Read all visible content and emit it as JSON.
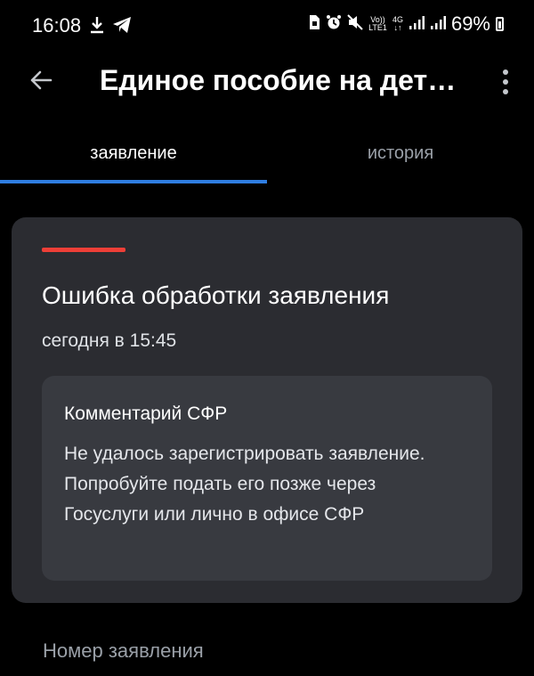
{
  "status_bar": {
    "time": "16:08",
    "left_icons": [
      "download-icon",
      "telegram-icon"
    ],
    "right_icons": [
      "sim-icon",
      "alarm-icon",
      "mute-icon"
    ],
    "volte_label_top": "Vo))",
    "volte_label_bottom": "LTE1",
    "network_label": "4G",
    "battery": "69%"
  },
  "app_bar": {
    "title": "Единое пособие на дет…"
  },
  "tabs": [
    {
      "label": "заявление",
      "active": true
    },
    {
      "label": "история",
      "active": false
    }
  ],
  "card": {
    "title": "Ошибка обработки заявления",
    "date": "сегодня в 15:45",
    "comment": {
      "title": "Комментарий СФР",
      "text": "Не удалось зарегистрировать заявление. Попробуйте подать его позже через Госуслуги или лично в офисе СФР"
    }
  },
  "footer": {
    "label": "Номер заявления"
  },
  "colors": {
    "accent": "#2f7de1",
    "error": "#ee3f37",
    "card_bg": "#2b2c31",
    "comment_bg": "#383a40"
  }
}
